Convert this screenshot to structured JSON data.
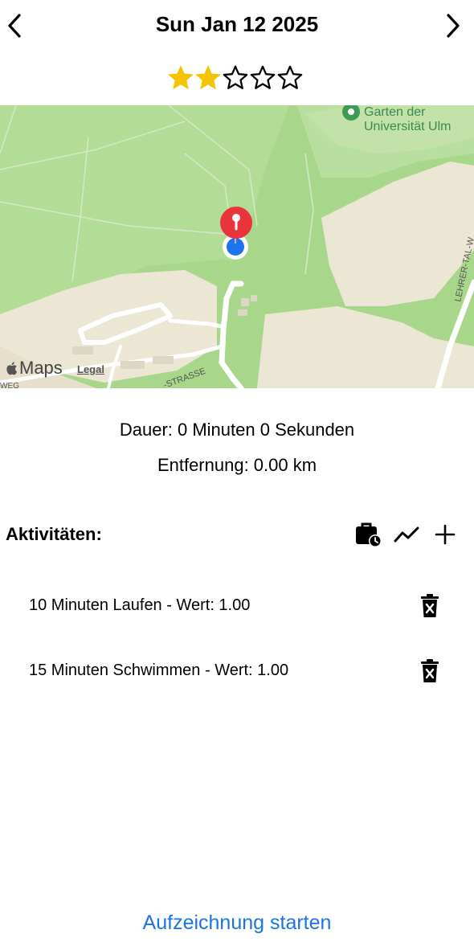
{
  "header": {
    "title": "Sun Jan 12 2025",
    "prev_icon": "chevron-left-icon",
    "next_icon": "chevron-right-icon"
  },
  "rating": {
    "value": 2,
    "max": 5,
    "filled_color": "#f5c400"
  },
  "map": {
    "label_line1": "Garten der",
    "label_line2": "Universität Ulm",
    "street_label": "LEHRER-TAL-W",
    "street_label_bottom": "-STRASSE",
    "street_label_left": "WEG",
    "logo_text": "Maps",
    "legal_text": "Legal"
  },
  "summary": {
    "duration": "Dauer: 0 Minuten 0 Sekunden",
    "distance": "Entfernung: 0.00 km"
  },
  "activities": {
    "title": "Aktivitäten:",
    "toolbar_icons": [
      "briefcase-clock-icon",
      "trend-chart-icon",
      "plus-icon"
    ],
    "items": [
      {
        "label": "10 Minuten Laufen - Wert: 1.00"
      },
      {
        "label": "15 Minuten Schwimmen - Wert: 1.00"
      }
    ]
  },
  "footer": {
    "record_button": "Aufzeichnung starten",
    "accent_color": "#1a74e8"
  }
}
